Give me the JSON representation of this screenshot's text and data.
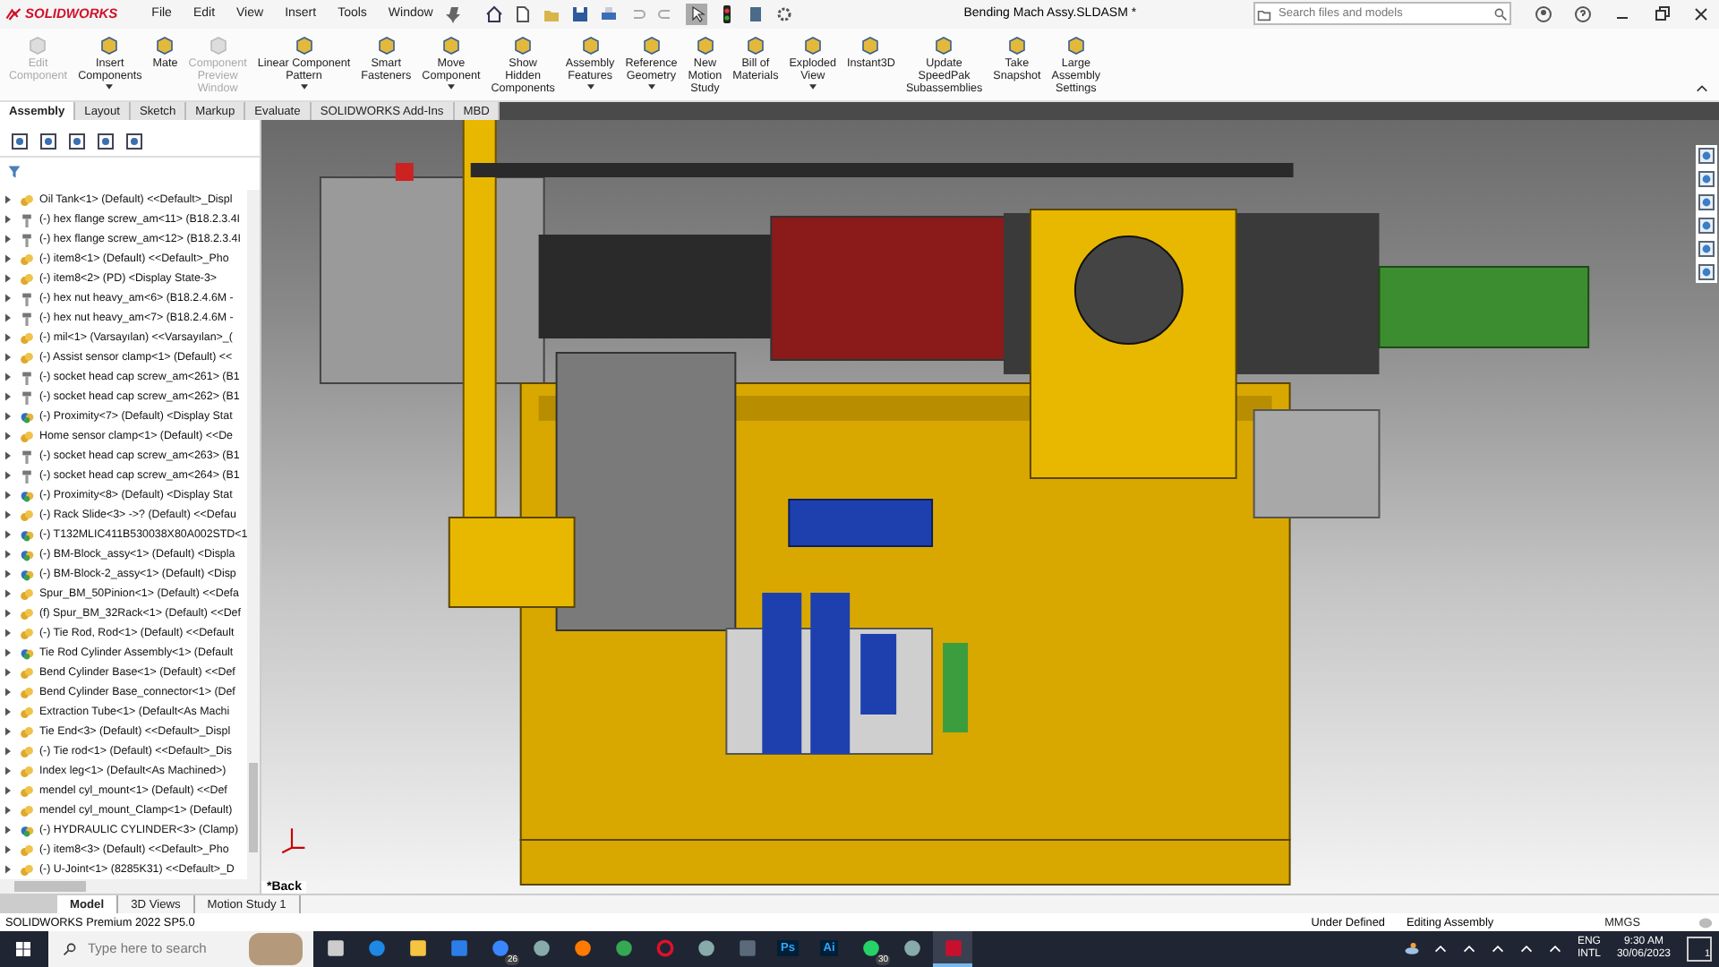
{
  "title_bar": {
    "brand": "SOLIDWORKS",
    "menus": [
      "File",
      "Edit",
      "View",
      "Insert",
      "Tools",
      "Window"
    ],
    "title": "Bending Mach Assy.SLDASM *",
    "search": {
      "placeholder": "Search files and models"
    }
  },
  "ribbon": [
    {
      "label": "Edit\nComponent",
      "disabled": true,
      "dropdown": false
    },
    {
      "label": "Insert\nComponents",
      "disabled": false,
      "dropdown": true
    },
    {
      "label": "Mate",
      "disabled": false,
      "dropdown": false
    },
    {
      "label": "Component\nPreview\nWindow",
      "disabled": true,
      "dropdown": false
    },
    {
      "label": "Linear Component\nPattern",
      "disabled": false,
      "dropdown": true
    },
    {
      "label": "Smart\nFasteners",
      "disabled": false,
      "dropdown": false
    },
    {
      "label": "Move\nComponent",
      "disabled": false,
      "dropdown": true
    },
    {
      "label": "Show\nHidden\nComponents",
      "disabled": false,
      "dropdown": false
    },
    {
      "label": "Assembly\nFeatures",
      "disabled": false,
      "dropdown": true
    },
    {
      "label": "Reference\nGeometry",
      "disabled": false,
      "dropdown": true
    },
    {
      "label": "New\nMotion\nStudy",
      "disabled": false,
      "dropdown": false
    },
    {
      "label": "Bill of\nMaterials",
      "disabled": false,
      "dropdown": false
    },
    {
      "label": "Exploded\nView",
      "disabled": false,
      "dropdown": true
    },
    {
      "label": "Instant3D",
      "disabled": false,
      "dropdown": false
    },
    {
      "label": "Update\nSpeedPak\nSubassemblies",
      "disabled": false,
      "dropdown": false
    },
    {
      "label": "Take\nSnapshot",
      "disabled": false,
      "dropdown": false
    },
    {
      "label": "Large\nAssembly\nSettings",
      "disabled": false,
      "dropdown": false
    }
  ],
  "tabs": [
    {
      "label": "Assembly",
      "selected": true
    },
    {
      "label": "Layout",
      "selected": false
    },
    {
      "label": "Sketch",
      "selected": false
    },
    {
      "label": "Markup",
      "selected": false
    },
    {
      "label": "Evaluate",
      "selected": false
    },
    {
      "label": "SOLIDWORKS Add-Ins",
      "selected": false
    },
    {
      "label": "MBD",
      "selected": false
    }
  ],
  "tree": [
    {
      "kind": "part",
      "label": "Oil Tank<1> (Default) <<Default>_Displ"
    },
    {
      "kind": "screw",
      "label": "(-) hex flange screw_am<11> (B18.2.3.4I"
    },
    {
      "kind": "screw",
      "label": "(-) hex flange screw_am<12> (B18.2.3.4I"
    },
    {
      "kind": "part",
      "label": "(-) item8<1> (Default) <<Default>_Pho"
    },
    {
      "kind": "part",
      "label": "(-) item8<2> (PD) <Display State-3>"
    },
    {
      "kind": "screw",
      "label": "(-) hex nut heavy_am<6> (B18.2.4.6M -"
    },
    {
      "kind": "screw",
      "label": "(-) hex nut heavy_am<7> (B18.2.4.6M -"
    },
    {
      "kind": "part",
      "label": "(-) mil<1> (Varsayılan) <<Varsayılan>_("
    },
    {
      "kind": "part",
      "label": "(-) Assist sensor clamp<1> (Default) <<"
    },
    {
      "kind": "screw",
      "label": "(-) socket head cap screw_am<261> (B1"
    },
    {
      "kind": "screw",
      "label": "(-) socket head cap screw_am<262> (B1"
    },
    {
      "kind": "assembly",
      "label": "(-) Proximity<7> (Default) <Display Stat"
    },
    {
      "kind": "part",
      "label": "Home sensor clamp<1> (Default) <<De"
    },
    {
      "kind": "screw",
      "label": "(-) socket head cap screw_am<263> (B1"
    },
    {
      "kind": "screw",
      "label": "(-) socket head cap screw_am<264> (B1"
    },
    {
      "kind": "assembly",
      "label": "(-) Proximity<8> (Default) <Display Stat"
    },
    {
      "kind": "part",
      "label": "(-) Rack Slide<3> ->? (Default) <<Defau"
    },
    {
      "kind": "assembly",
      "label": "(-) T132MLIC411B530038X80A002STD<1"
    },
    {
      "kind": "assembly",
      "label": "(-) BM-Block_assy<1> (Default) <Displa"
    },
    {
      "kind": "assembly",
      "label": "(-) BM-Block-2_assy<1> (Default) <Disp"
    },
    {
      "kind": "part",
      "label": "Spur_BM_50Pinion<1> (Default) <<Defa"
    },
    {
      "kind": "part",
      "label": "(f) Spur_BM_32Rack<1> (Default) <<Def"
    },
    {
      "kind": "part",
      "label": "(-) Tie Rod, Rod<1> (Default) <<Default"
    },
    {
      "kind": "assembly",
      "label": "Tie Rod Cylinder Assembly<1> (Default"
    },
    {
      "kind": "part",
      "label": "Bend Cylinder Base<1> (Default) <<Def"
    },
    {
      "kind": "part",
      "label": "Bend Cylinder Base_connector<1> (Def"
    },
    {
      "kind": "part",
      "label": "Extraction Tube<1> (Default<As Machi"
    },
    {
      "kind": "part",
      "label": "Tie End<3> (Default) <<Default>_Displ"
    },
    {
      "kind": "part",
      "label": "(-) Tie rod<1> (Default) <<Default>_Dis"
    },
    {
      "kind": "part",
      "label": "Index leg<1> (Default<As Machined>)"
    },
    {
      "kind": "part",
      "label": "mendel cyl_mount<1> (Default) <<Def"
    },
    {
      "kind": "part",
      "label": "mendel cyl_mount_Clamp<1> (Default)"
    },
    {
      "kind": "assembly",
      "label": "(-) HYDRAULIC CYLINDER<3> (Clamp)"
    },
    {
      "kind": "part",
      "label": "(-) item8<3> (Default) <<Default>_Pho"
    },
    {
      "kind": "part",
      "label": "(-) U-Joint<1> (8285K31) <<Default>_D"
    }
  ],
  "viewport": {
    "view_label": "*Back"
  },
  "bottom_tabs": [
    {
      "label": "Model",
      "selected": true
    },
    {
      "label": "3D Views",
      "selected": false
    },
    {
      "label": "Motion Study 1",
      "selected": false
    }
  ],
  "status_bar": {
    "product": "SOLIDWORKS Premium 2022 SP5.0",
    "definition": "Under Defined",
    "mode": "Editing Assembly",
    "units": "MMGS"
  },
  "taskbar": {
    "search": {
      "placeholder": "Type here to search"
    },
    "apps": [
      {
        "kind": "task-view",
        "selected": false
      },
      {
        "kind": "edge",
        "selected": false
      },
      {
        "kind": "explorer",
        "selected": false
      },
      {
        "kind": "store",
        "selected": false
      },
      {
        "kind": "mail",
        "badge": "26",
        "selected": false
      },
      {
        "kind": "app",
        "selected": false
      },
      {
        "kind": "firefox",
        "selected": false
      },
      {
        "kind": "chrome",
        "selected": false
      },
      {
        "kind": "opera",
        "selected": false
      },
      {
        "kind": "app",
        "selected": false
      },
      {
        "kind": "calculator",
        "selected": false
      },
      {
        "kind": "letters",
        "label": "Ps",
        "selected": false
      },
      {
        "kind": "letters",
        "label": "Ai",
        "selected": false
      },
      {
        "kind": "whatsapp",
        "badge": "30",
        "selected": false
      },
      {
        "kind": "app",
        "selected": false
      },
      {
        "kind": "solidworks",
        "selected": true
      }
    ],
    "language": "ENG",
    "layout": "INTL",
    "time": "9:30 AM",
    "date": "30/06/2023",
    "notifications": "1"
  }
}
